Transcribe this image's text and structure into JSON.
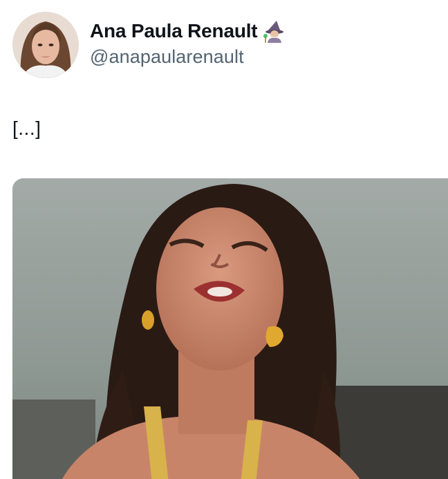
{
  "tweet": {
    "author": {
      "display_name": "Ana Paula Renault",
      "handle": "@anapaularenault",
      "badge_emoji": "wizard-emoji"
    },
    "text": "[...]",
    "media": {
      "type": "image"
    }
  },
  "icons": {
    "avatar": "profile-photo",
    "badge": "wizard-emoji-icon"
  }
}
